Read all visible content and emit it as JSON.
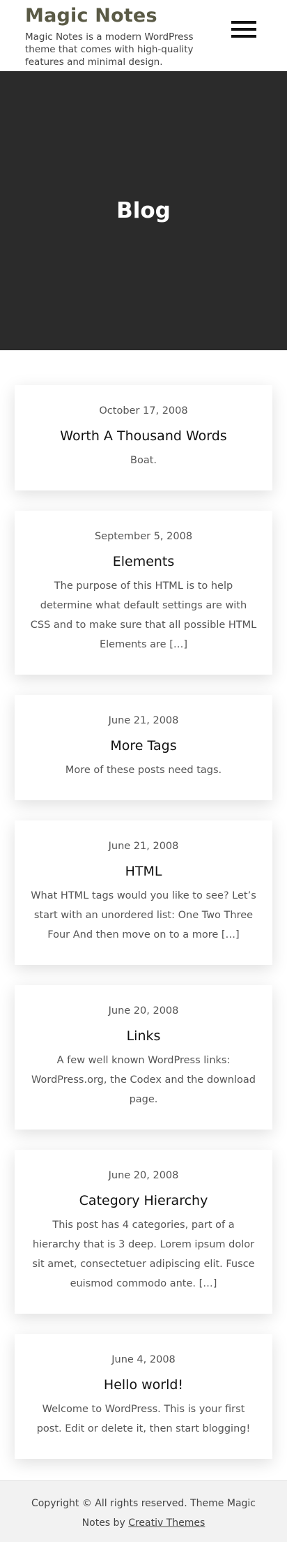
{
  "header": {
    "site_title": "Magic Notes",
    "site_description": "Magic Notes is a modern WordPress theme that comes with high-quality features and minimal design."
  },
  "hero": {
    "title": "Blog"
  },
  "posts": [
    {
      "date": "October 17, 2008",
      "title": "Worth A Thousand Words",
      "excerpt": "Boat."
    },
    {
      "date": "September 5, 2008",
      "title": "Elements",
      "excerpt": "The purpose of this HTML is to help determine what default settings are with CSS and to make sure that all possible HTML Elements are […]"
    },
    {
      "date": "June 21, 2008",
      "title": "More Tags",
      "excerpt": "More of these posts need tags."
    },
    {
      "date": "June 21, 2008",
      "title": "HTML",
      "excerpt": "What HTML tags would you like to see? Let’s start with an unordered list: One Two Three Four And then move on to a more […]"
    },
    {
      "date": "June 20, 2008",
      "title": "Links",
      "excerpt": "A few well known WordPress links: WordPress.org, the Codex and the download page."
    },
    {
      "date": "June 20, 2008",
      "title": "Category Hierarchy",
      "excerpt": "This post has 4 categories, part of a hierarchy that is 3 deep. Lorem ipsum dolor sit amet, consectetuer adipiscing elit. Fusce euismod commodo ante. […]"
    },
    {
      "date": "June 4, 2008",
      "title": "Hello world!",
      "excerpt": "Welcome to WordPress. This is your first post. Edit or delete it, then start blogging!"
    }
  ],
  "footer": {
    "copyright": "Copyright © All rights reserved. Theme Magic Notes by ",
    "credit_link": "Creativ Themes"
  },
  "colors": {
    "hero_background": "#2b2b2b",
    "site_title": "#5a5a46",
    "footer_background": "#f2f2f2"
  }
}
